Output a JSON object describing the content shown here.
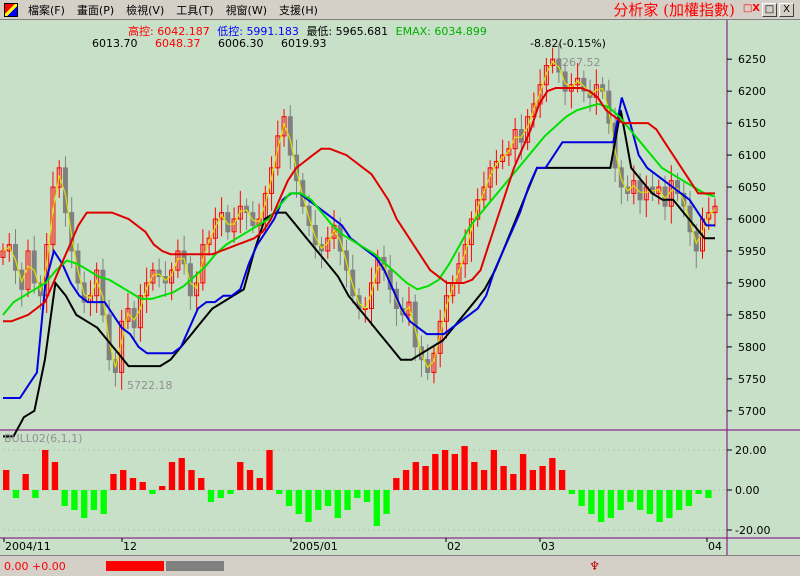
{
  "menu": {
    "items": [
      "檔案(F)",
      "畫面(P)",
      "檢視(V)",
      "工具(T)",
      "視窗(W)",
      "支援(H)"
    ],
    "app_title": "分析家 (加權指數)"
  },
  "window_controls": {
    "restore_label": "□",
    "close_label": "X",
    "extra_label": "□X"
  },
  "price_info": {
    "high_label": "高控:",
    "high_value": "6042.187",
    "low_label": "低控:",
    "low_value": "5991.183",
    "lowest_label": "最低:",
    "lowest_value": "5965.681",
    "emax_label": "EMAX:",
    "emax_value": "6034.899",
    "values": [
      "6013.70",
      "6048.37",
      "6006.30",
      "6019.93"
    ],
    "change": "-8.82(-0.15%)",
    "high_mark": "6267.52",
    "low_mark": "5722.18"
  },
  "indicator": {
    "label": "BULL02(6,1,1)",
    "y_ticks": [
      "20.00",
      "0.00",
      "-20.00"
    ]
  },
  "price_axis": {
    "ticks": [
      "6250",
      "6200",
      "6150",
      "6100",
      "6050",
      "6000",
      "5950",
      "5900",
      "5850",
      "5800",
      "5750",
      "5700"
    ]
  },
  "time_axis": {
    "labels": [
      "2004/11",
      "12",
      "2005/01",
      "02",
      "03",
      "04"
    ]
  },
  "colors": {
    "background": "#c8e0c8",
    "up_candle": "#ff0000",
    "down_candle": "#808080",
    "red_line": "#e00000",
    "blue_line": "#0000e0",
    "green_line": "#00e000",
    "black_line": "#000000",
    "yellow_line": "#e0e000"
  },
  "status": {
    "value": "0.00 +0.00"
  },
  "chart_data": {
    "type": "line",
    "ylim": [
      5670,
      6280
    ],
    "close": [
      5950,
      5960,
      5920,
      5890,
      5950,
      5900,
      5880,
      5960,
      6050,
      6080,
      6010,
      5950,
      5900,
      5870,
      5880,
      5920,
      5850,
      5780,
      5760,
      5840,
      5860,
      5830,
      5880,
      5900,
      5920,
      5910,
      5900,
      5920,
      5950,
      5930,
      5880,
      5900,
      5960,
      5970,
      6000,
      6010,
      5980,
      6000,
      6020,
      6010,
      5990,
      6000,
      6040,
      6080,
      6130,
      6160,
      6100,
      6060,
      6020,
      5990,
      5960,
      5950,
      5970,
      5990,
      5950,
      5920,
      5880,
      5860,
      5860,
      5900,
      5940,
      5920,
      5890,
      5860,
      5850,
      5870,
      5800,
      5780,
      5760,
      5790,
      5840,
      5880,
      5900,
      5930,
      5960,
      6000,
      6030,
      6050,
      6080,
      6090,
      6100,
      6110,
      6140,
      6120,
      6160,
      6180,
      6210,
      6240,
      6250,
      6230,
      6200,
      6210,
      6220,
      6200,
      6190,
      6210,
      6200,
      6150,
      6080,
      6050,
      6040,
      6060,
      6030,
      6050,
      6040,
      6050,
      6020,
      6060,
      6040,
      6020,
      5980,
      5950,
      6000,
      6010,
      6020
    ],
    "red_line": [
      5840,
      5840,
      5845,
      5850,
      5860,
      5870,
      5900,
      5930,
      5960,
      5990,
      6010,
      6010,
      6010,
      6010,
      6005,
      6000,
      5990,
      5980,
      5960,
      5950,
      5945,
      5945,
      5945,
      5945,
      5945,
      5945,
      5950,
      5955,
      5960,
      5965,
      5970,
      5980,
      6000,
      6030,
      6060,
      6080,
      6090,
      6100,
      6110,
      6110,
      6105,
      6100,
      6090,
      6080,
      6070,
      6050,
      6030,
      6000,
      5980,
      5960,
      5940,
      5920,
      5910,
      5900,
      5900,
      5900,
      5905,
      5920,
      5960,
      6000,
      6040,
      6080,
      6110,
      6140,
      6180,
      6200,
      6205,
      6205,
      6205,
      6205,
      6200,
      6190,
      6170,
      6160,
      6150,
      6150,
      6150,
      6150,
      6140,
      6120,
      6100,
      6080,
      6060,
      6040,
      6040,
      6040
    ],
    "blue_line": [
      5720,
      5720,
      5720,
      5740,
      5760,
      5900,
      5950,
      5930,
      5900,
      5880,
      5870,
      5870,
      5870,
      5850,
      5830,
      5820,
      5800,
      5790,
      5790,
      5790,
      5790,
      5800,
      5830,
      5860,
      5870,
      5870,
      5880,
      5880,
      5890,
      5930,
      5960,
      5980,
      6000,
      6030,
      6040,
      6040,
      6030,
      6020,
      6010,
      6000,
      5990,
      5970,
      5960,
      5950,
      5940,
      5920,
      5890,
      5860,
      5840,
      5830,
      5820,
      5820,
      5820,
      5830,
      5840,
      5850,
      5860,
      5880,
      5920,
      5950,
      5980,
      6010,
      6050,
      6080,
      6080,
      6100,
      6120,
      6120,
      6120,
      6120,
      6120,
      6120,
      6120,
      6190,
      6150,
      6100,
      6080,
      6070,
      6060,
      6050,
      6040,
      6030,
      6010,
      5990,
      5990
    ],
    "green_line": [
      5850,
      5870,
      5880,
      5890,
      5900,
      5920,
      5935,
      5930,
      5920,
      5910,
      5905,
      5895,
      5885,
      5875,
      5875,
      5880,
      5885,
      5895,
      5910,
      5925,
      5945,
      5960,
      5970,
      5980,
      5990,
      6000,
      6020,
      6040,
      6040,
      6030,
      6010,
      5990,
      5975,
      5965,
      5955,
      5945,
      5930,
      5915,
      5900,
      5890,
      5895,
      5905,
      5930,
      5960,
      5990,
      6010,
      6030,
      6050,
      6070,
      6090,
      6110,
      6130,
      6145,
      6160,
      6170,
      6175,
      6180,
      6175,
      6160,
      6140,
      6120,
      6100,
      6080,
      6070,
      6060,
      6050,
      6040,
      6035
    ],
    "black_line": [
      5660,
      5660,
      5690,
      5700,
      5780,
      5900,
      5880,
      5850,
      5840,
      5830,
      5810,
      5790,
      5770,
      5770,
      5770,
      5770,
      5780,
      5800,
      5820,
      5840,
      5860,
      5870,
      5880,
      5890,
      5950,
      6000,
      6010,
      6010,
      5990,
      5970,
      5950,
      5930,
      5910,
      5880,
      5860,
      5840,
      5820,
      5800,
      5780,
      5780,
      5790,
      5800,
      5810,
      5830,
      5850,
      5870,
      5890,
      5920,
      5960,
      6000,
      6040,
      6080,
      6080,
      6080,
      6080,
      6080,
      6080,
      6080,
      6080,
      6170,
      6080,
      6060,
      6040,
      6030,
      6030,
      6010,
      5990,
      5970,
      5970
    ],
    "indicator": [
      10,
      -4,
      8,
      -4,
      20,
      14,
      -8,
      -10,
      -14,
      -10,
      -12,
      8,
      10,
      6,
      4,
      -2,
      2,
      14,
      16,
      10,
      6,
      -6,
      -4,
      -2,
      14,
      10,
      6,
      20,
      -2,
      -8,
      -12,
      -16,
      -10,
      -8,
      -14,
      -10,
      -4,
      -6,
      -18,
      -12,
      6,
      10,
      14,
      12,
      18,
      20,
      18,
      22,
      14,
      10,
      20,
      12,
      8,
      18,
      10,
      12,
      16,
      10,
      -2,
      -8,
      -12,
      -16,
      -14,
      -10,
      -6,
      -10,
      -12,
      -16,
      -14,
      -10,
      -8,
      -2,
      -4
    ],
    "x_labels": [
      "2004/11",
      "12",
      "2005/01",
      "02",
      "03",
      "04"
    ]
  }
}
